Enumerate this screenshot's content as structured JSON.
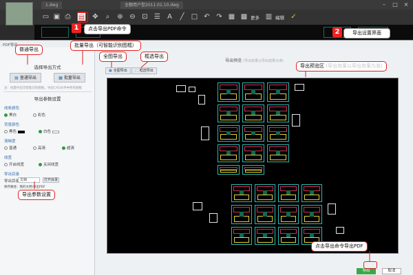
{
  "window": {
    "tab_left": "1.dwg",
    "tab_title": "全额用户型2011.01.10.dwg"
  },
  "toolbar": {
    "more": "更多",
    "edit": "编辑"
  },
  "dialog": {
    "title": "PDF导出",
    "section_method": "选择导出方式",
    "btn_normal": "普通导出",
    "btn_batch": "批量导出",
    "hint": "注：批量导出可智能识别图框，导出CAD文件中所有图框",
    "section_params": "导出参数设置",
    "groups": [
      {
        "label": "线条颜色",
        "options": [
          {
            "text": "黑白",
            "on": true
          },
          {
            "text": "彩色",
            "on": false
          }
        ]
      },
      {
        "label": "背景颜色",
        "options": [
          {
            "text": "黑色",
            "on": false,
            "swatch": "#000000"
          },
          {
            "text": "白色",
            "on": true,
            "swatch": "#ffffff"
          }
        ]
      },
      {
        "label": "清晰度",
        "options": [
          {
            "text": "普通",
            "on": false
          },
          {
            "text": "高清",
            "on": false
          },
          {
            "text": "超清",
            "on": true
          }
        ]
      },
      {
        "label": "线宽",
        "options": [
          {
            "text": "开启线宽",
            "on": false
          },
          {
            "text": "关闭线宽",
            "on": true
          }
        ]
      }
    ],
    "output_dir_label": "导出目录",
    "output_dir_value": "文档",
    "open_folder": "打开目录",
    "save_path": "保存路径：我的文档\\导出PDF",
    "preview_title": "导出预览",
    "preview_sub": "(导出效果以导出效果为准)",
    "btn_whole": "全图导出",
    "btn_region": "框选导出",
    "btn_export": "导出",
    "btn_cancel": "取消"
  },
  "annotations": {
    "step1_num": "1",
    "step1": "点击导出PDF命令",
    "step2_num": "2",
    "step2": "导出设置界面",
    "batch": "批量导出（可智能识别图框）",
    "normal": "普通导出",
    "whole": "全图导出",
    "region": "框选导出",
    "preview": "导出预览区",
    "preview_gray": "(导出效果以导出效果为准)",
    "params": "导出参数设置",
    "click_export": "点击导出命令导出PDF"
  },
  "colors": {
    "accent_red": "#e02020",
    "cad_cyan": "#2bbcb4",
    "export_green": "#3aa84a"
  }
}
